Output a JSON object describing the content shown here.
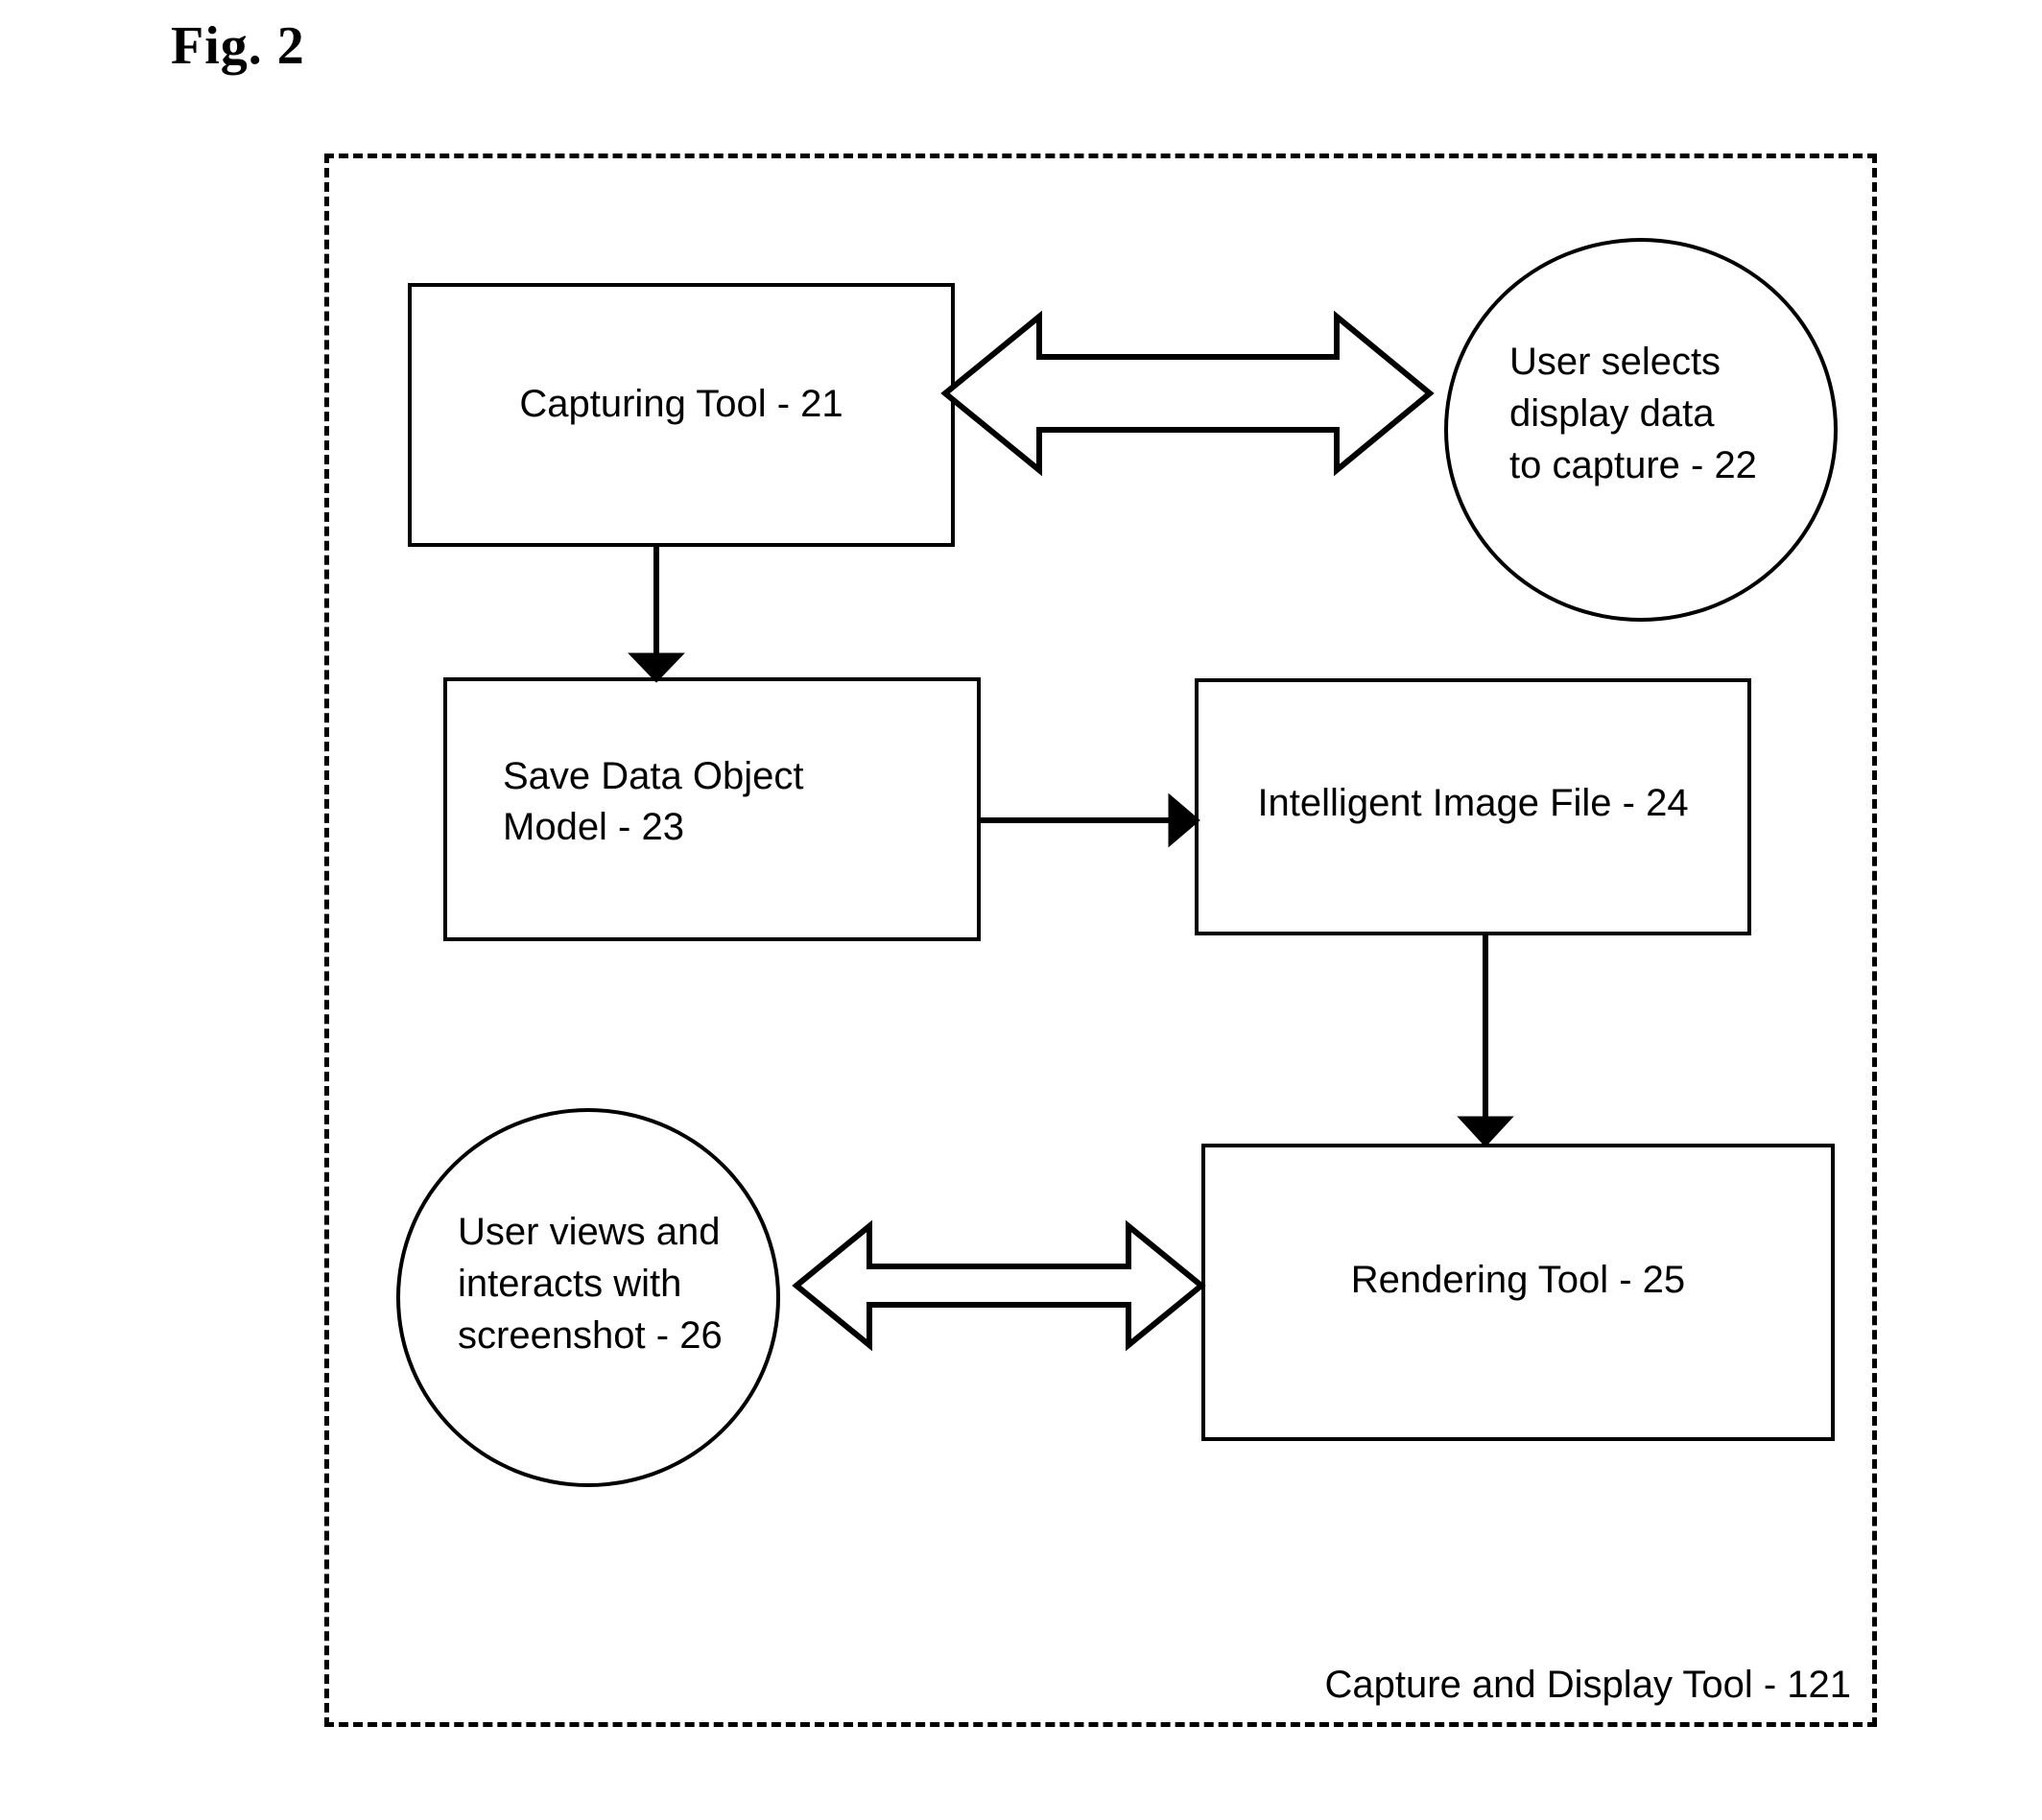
{
  "figure": {
    "title": "Fig. 2"
  },
  "container": {
    "label": "Capture and Display Tool - 121",
    "style": "dashed"
  },
  "nodes": {
    "capturing_tool": {
      "label": "Capturing Tool - 21",
      "shape": "rectangle",
      "ref": "21"
    },
    "user_selects": {
      "label": "User selects\ndisplay data\nto capture - 22",
      "shape": "ellipse",
      "ref": "22"
    },
    "save_data_object_model": {
      "label": "Save Data Object\nModel - 23",
      "shape": "rectangle",
      "ref": "23"
    },
    "intelligent_image_file": {
      "label": "Intelligent Image File - 24",
      "shape": "rectangle",
      "ref": "24"
    },
    "rendering_tool": {
      "label": "Rendering Tool - 25",
      "shape": "rectangle",
      "ref": "25"
    },
    "user_views": {
      "label": "User views  and\ninteracts with\nscreenshot - 26",
      "shape": "ellipse",
      "ref": "26"
    }
  },
  "connectors": [
    {
      "name": "capturing-tool-to-user-selects",
      "from": "capturing_tool",
      "to": "user_selects",
      "style": "block-double-arrow",
      "direction": "bidirectional"
    },
    {
      "name": "capturing-tool-to-save-data-object-model",
      "from": "capturing_tool",
      "to": "save_data_object_model",
      "style": "line-arrow",
      "direction": "down"
    },
    {
      "name": "save-data-object-model-to-intelligent-image-file",
      "from": "save_data_object_model",
      "to": "intelligent_image_file",
      "style": "line-arrow",
      "direction": "right"
    },
    {
      "name": "intelligent-image-file-to-rendering-tool",
      "from": "intelligent_image_file",
      "to": "rendering_tool",
      "style": "line-arrow",
      "direction": "down"
    },
    {
      "name": "user-views-to-rendering-tool",
      "from": "user_views",
      "to": "rendering_tool",
      "style": "block-double-arrow",
      "direction": "bidirectional"
    }
  ],
  "colors": {
    "stroke": "#000000",
    "background": "#ffffff"
  }
}
